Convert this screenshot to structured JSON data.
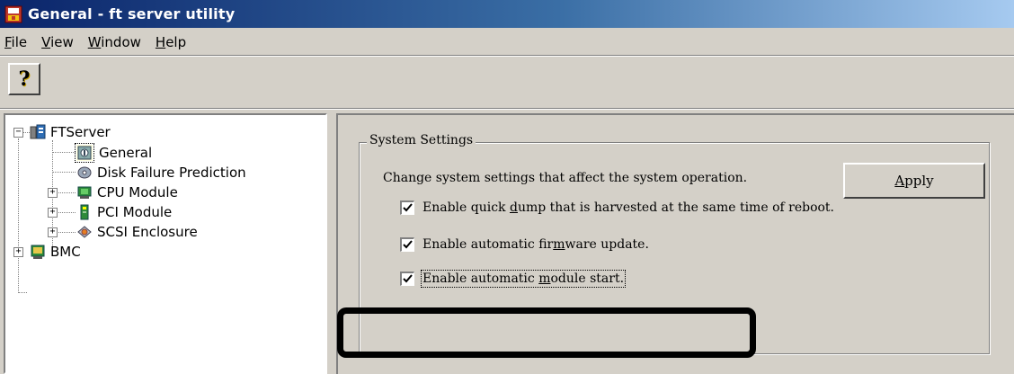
{
  "window": {
    "title": "General - ft server utility"
  },
  "menu": [
    {
      "label": "File",
      "mnemonic": "F",
      "rest": "ile"
    },
    {
      "label": "View",
      "mnemonic": "V",
      "rest": "iew"
    },
    {
      "label": "Window",
      "mnemonic": "W",
      "rest": "indow"
    },
    {
      "label": "Help",
      "mnemonic": "H",
      "rest": "elp"
    }
  ],
  "toolbar": {
    "help_glyph": "?",
    "help_icon": "help-icon"
  },
  "tree": {
    "root": {
      "label": "FTServer",
      "icon": "server-icon"
    },
    "items": [
      {
        "label": "General",
        "icon": "general-icon",
        "selected": true
      },
      {
        "label": "Disk Failure Prediction",
        "icon": "disk-icon"
      },
      {
        "label": "CPU Module",
        "icon": "cpu-module-icon"
      },
      {
        "label": "PCI Module",
        "icon": "pci-module-icon"
      },
      {
        "label": "SCSI Enclosure",
        "icon": "scsi-enclosure-icon"
      }
    ],
    "bmc": {
      "label": "BMC",
      "icon": "bmc-icon"
    }
  },
  "settings": {
    "group_title": "System Settings",
    "description": "Change system settings that affect the system operation.",
    "apply": {
      "label_pre": "",
      "mnemonic": "A",
      "label_post": "pply"
    },
    "checkboxes": [
      {
        "pre": "Enable quick ",
        "mnemonic": "d",
        "post": "ump that is harvested at the same time of reboot.",
        "checked": true
      },
      {
        "pre": "Enable automatic fir",
        "mnemonic": "m",
        "post": "ware update.",
        "checked": true
      },
      {
        "pre": "Enable automatic ",
        "mnemonic": "m",
        "post": "odule start.",
        "checked": true
      }
    ]
  }
}
